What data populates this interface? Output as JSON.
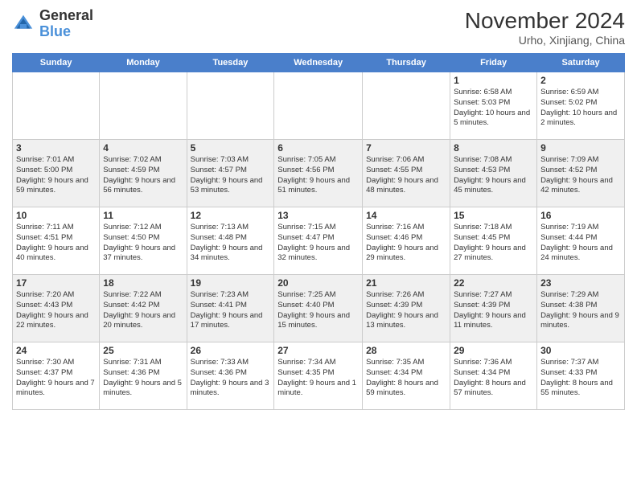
{
  "header": {
    "logo_general": "General",
    "logo_blue": "Blue",
    "month_title": "November 2024",
    "subtitle": "Urho, Xinjiang, China"
  },
  "days_of_week": [
    "Sunday",
    "Monday",
    "Tuesday",
    "Wednesday",
    "Thursday",
    "Friday",
    "Saturday"
  ],
  "weeks": [
    {
      "row_class": "row-odd",
      "days": [
        {
          "num": "",
          "sunrise": "",
          "sunset": "",
          "daylight": ""
        },
        {
          "num": "",
          "sunrise": "",
          "sunset": "",
          "daylight": ""
        },
        {
          "num": "",
          "sunrise": "",
          "sunset": "",
          "daylight": ""
        },
        {
          "num": "",
          "sunrise": "",
          "sunset": "",
          "daylight": ""
        },
        {
          "num": "",
          "sunrise": "",
          "sunset": "",
          "daylight": ""
        },
        {
          "num": "1",
          "sunrise": "Sunrise: 6:58 AM",
          "sunset": "Sunset: 5:03 PM",
          "daylight": "Daylight: 10 hours and 5 minutes."
        },
        {
          "num": "2",
          "sunrise": "Sunrise: 6:59 AM",
          "sunset": "Sunset: 5:02 PM",
          "daylight": "Daylight: 10 hours and 2 minutes."
        }
      ]
    },
    {
      "row_class": "row-even",
      "days": [
        {
          "num": "3",
          "sunrise": "Sunrise: 7:01 AM",
          "sunset": "Sunset: 5:00 PM",
          "daylight": "Daylight: 9 hours and 59 minutes."
        },
        {
          "num": "4",
          "sunrise": "Sunrise: 7:02 AM",
          "sunset": "Sunset: 4:59 PM",
          "daylight": "Daylight: 9 hours and 56 minutes."
        },
        {
          "num": "5",
          "sunrise": "Sunrise: 7:03 AM",
          "sunset": "Sunset: 4:57 PM",
          "daylight": "Daylight: 9 hours and 53 minutes."
        },
        {
          "num": "6",
          "sunrise": "Sunrise: 7:05 AM",
          "sunset": "Sunset: 4:56 PM",
          "daylight": "Daylight: 9 hours and 51 minutes."
        },
        {
          "num": "7",
          "sunrise": "Sunrise: 7:06 AM",
          "sunset": "Sunset: 4:55 PM",
          "daylight": "Daylight: 9 hours and 48 minutes."
        },
        {
          "num": "8",
          "sunrise": "Sunrise: 7:08 AM",
          "sunset": "Sunset: 4:53 PM",
          "daylight": "Daylight: 9 hours and 45 minutes."
        },
        {
          "num": "9",
          "sunrise": "Sunrise: 7:09 AM",
          "sunset": "Sunset: 4:52 PM",
          "daylight": "Daylight: 9 hours and 42 minutes."
        }
      ]
    },
    {
      "row_class": "row-odd",
      "days": [
        {
          "num": "10",
          "sunrise": "Sunrise: 7:11 AM",
          "sunset": "Sunset: 4:51 PM",
          "daylight": "Daylight: 9 hours and 40 minutes."
        },
        {
          "num": "11",
          "sunrise": "Sunrise: 7:12 AM",
          "sunset": "Sunset: 4:50 PM",
          "daylight": "Daylight: 9 hours and 37 minutes."
        },
        {
          "num": "12",
          "sunrise": "Sunrise: 7:13 AM",
          "sunset": "Sunset: 4:48 PM",
          "daylight": "Daylight: 9 hours and 34 minutes."
        },
        {
          "num": "13",
          "sunrise": "Sunrise: 7:15 AM",
          "sunset": "Sunset: 4:47 PM",
          "daylight": "Daylight: 9 hours and 32 minutes."
        },
        {
          "num": "14",
          "sunrise": "Sunrise: 7:16 AM",
          "sunset": "Sunset: 4:46 PM",
          "daylight": "Daylight: 9 hours and 29 minutes."
        },
        {
          "num": "15",
          "sunrise": "Sunrise: 7:18 AM",
          "sunset": "Sunset: 4:45 PM",
          "daylight": "Daylight: 9 hours and 27 minutes."
        },
        {
          "num": "16",
          "sunrise": "Sunrise: 7:19 AM",
          "sunset": "Sunset: 4:44 PM",
          "daylight": "Daylight: 9 hours and 24 minutes."
        }
      ]
    },
    {
      "row_class": "row-even",
      "days": [
        {
          "num": "17",
          "sunrise": "Sunrise: 7:20 AM",
          "sunset": "Sunset: 4:43 PM",
          "daylight": "Daylight: 9 hours and 22 minutes."
        },
        {
          "num": "18",
          "sunrise": "Sunrise: 7:22 AM",
          "sunset": "Sunset: 4:42 PM",
          "daylight": "Daylight: 9 hours and 20 minutes."
        },
        {
          "num": "19",
          "sunrise": "Sunrise: 7:23 AM",
          "sunset": "Sunset: 4:41 PM",
          "daylight": "Daylight: 9 hours and 17 minutes."
        },
        {
          "num": "20",
          "sunrise": "Sunrise: 7:25 AM",
          "sunset": "Sunset: 4:40 PM",
          "daylight": "Daylight: 9 hours and 15 minutes."
        },
        {
          "num": "21",
          "sunrise": "Sunrise: 7:26 AM",
          "sunset": "Sunset: 4:39 PM",
          "daylight": "Daylight: 9 hours and 13 minutes."
        },
        {
          "num": "22",
          "sunrise": "Sunrise: 7:27 AM",
          "sunset": "Sunset: 4:39 PM",
          "daylight": "Daylight: 9 hours and 11 minutes."
        },
        {
          "num": "23",
          "sunrise": "Sunrise: 7:29 AM",
          "sunset": "Sunset: 4:38 PM",
          "daylight": "Daylight: 9 hours and 9 minutes."
        }
      ]
    },
    {
      "row_class": "row-odd",
      "days": [
        {
          "num": "24",
          "sunrise": "Sunrise: 7:30 AM",
          "sunset": "Sunset: 4:37 PM",
          "daylight": "Daylight: 9 hours and 7 minutes."
        },
        {
          "num": "25",
          "sunrise": "Sunrise: 7:31 AM",
          "sunset": "Sunset: 4:36 PM",
          "daylight": "Daylight: 9 hours and 5 minutes."
        },
        {
          "num": "26",
          "sunrise": "Sunrise: 7:33 AM",
          "sunset": "Sunset: 4:36 PM",
          "daylight": "Daylight: 9 hours and 3 minutes."
        },
        {
          "num": "27",
          "sunrise": "Sunrise: 7:34 AM",
          "sunset": "Sunset: 4:35 PM",
          "daylight": "Daylight: 9 hours and 1 minute."
        },
        {
          "num": "28",
          "sunrise": "Sunrise: 7:35 AM",
          "sunset": "Sunset: 4:34 PM",
          "daylight": "Daylight: 8 hours and 59 minutes."
        },
        {
          "num": "29",
          "sunrise": "Sunrise: 7:36 AM",
          "sunset": "Sunset: 4:34 PM",
          "daylight": "Daylight: 8 hours and 57 minutes."
        },
        {
          "num": "30",
          "sunrise": "Sunrise: 7:37 AM",
          "sunset": "Sunset: 4:33 PM",
          "daylight": "Daylight: 8 hours and 55 minutes."
        }
      ]
    }
  ]
}
